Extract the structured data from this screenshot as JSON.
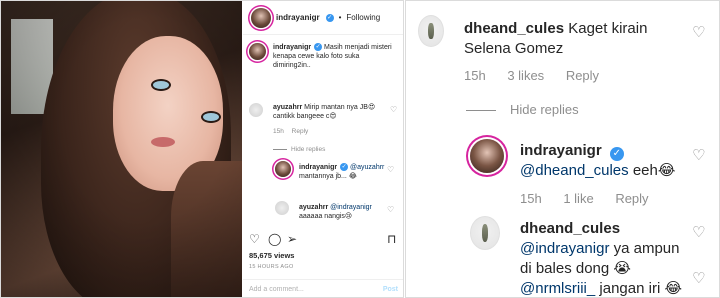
{
  "post": {
    "username": "indrayanigr",
    "dot": "•",
    "follow_label": "Following",
    "caption": "Masih menjadi misteri kenapa cewe kalo foto suka dimiring2in..",
    "comments": [
      {
        "username": "ayuzahrr",
        "text": "Mirip mantan nya JB😍 cantikk bangeee c😍",
        "time": "15h",
        "reply": "Reply",
        "hide_replies": "Hide replies",
        "replies": [
          {
            "username": "indrayanigr",
            "mention": "@ayuzahrr",
            "text": "mantannya jb... 😂"
          },
          {
            "username": "ayuzahrr",
            "mention": "@indrayanigr",
            "text": "aaaaaa nangis😢"
          }
        ]
      }
    ],
    "views": "85,675 views",
    "ago": "15 HOURS AGO",
    "add_comment_placeholder": "Add a comment...",
    "post_label": "Post"
  },
  "thread": [
    {
      "username": "dheand_cules",
      "text": "Kaget kirain Selena Gomez",
      "time": "15h",
      "likes": "3 likes",
      "reply": "Reply"
    },
    {
      "hide_replies": "Hide replies"
    },
    {
      "username": "indrayanigr",
      "mention": "@dheand_cules",
      "text": "eeh😂",
      "time": "15h",
      "likes": "1 like",
      "reply": "Reply"
    },
    {
      "username": "dheand_cules",
      "mention": "@indrayanigr",
      "text": "ya ampun di bales dong 😭",
      "mention2": "@nrmlsriii_",
      "text2": "jangan iri 😂"
    }
  ],
  "icons": {
    "heart": "heart-icon",
    "comment": "comment-icon",
    "share": "share-icon",
    "bookmark": "bookmark-icon",
    "verified": "verified-badge-icon"
  },
  "colors": {
    "text": "#262626",
    "muted": "#8e8e8e",
    "mention": "#00376b",
    "verified": "#3897f0",
    "story_ring": "#d6249f"
  }
}
